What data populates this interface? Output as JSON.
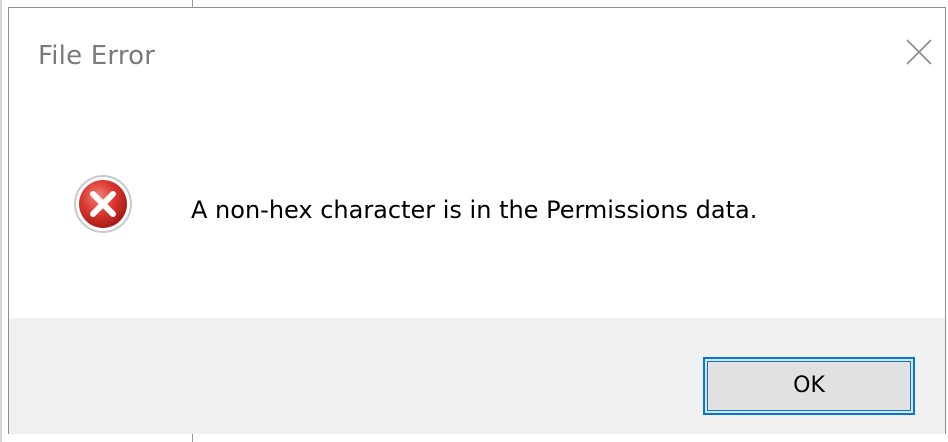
{
  "dialog": {
    "title": "File Error",
    "message": "A non-hex character is in the Permissions data.",
    "icon": "error-icon",
    "ok_label": "OK",
    "close_icon": "close-icon"
  },
  "colors": {
    "accent": "#0078d7",
    "error_red": "#d9362e",
    "footer_bg": "#f0f0f0"
  }
}
